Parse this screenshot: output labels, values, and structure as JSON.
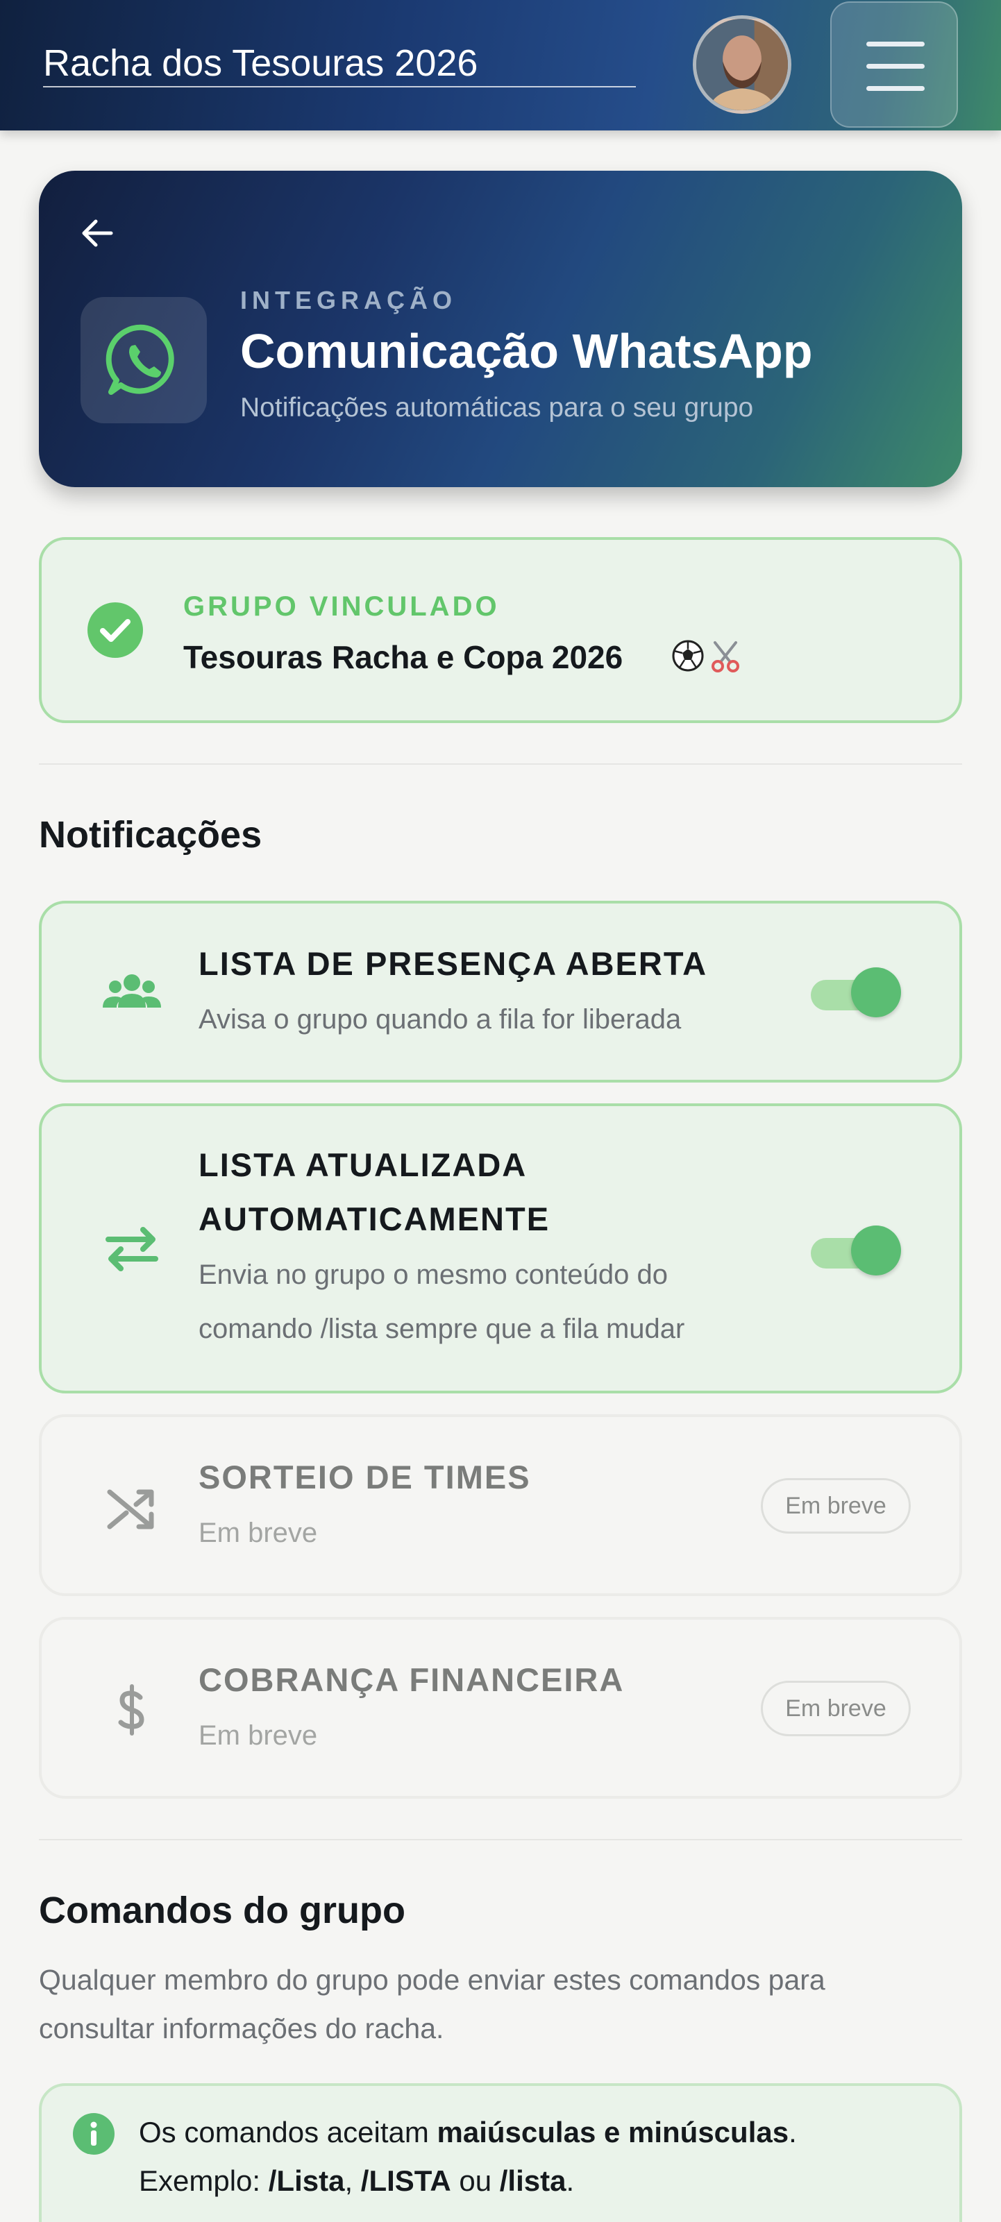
{
  "header": {
    "title": "Racha dos Tesouras 2026",
    "avatar_icon": "user-avatar",
    "menu_icon": "hamburger-menu-icon"
  },
  "hero": {
    "back_icon": "arrow-left-icon",
    "app_icon": "whatsapp-icon",
    "eyebrow": "INTEGRAÇÃO",
    "title": "Comunicação WhatsApp",
    "subtitle": "Notificações automáticas para o seu grupo"
  },
  "linked_group": {
    "status_icon": "check-circle-icon",
    "label": "GRUPO VINCULADO",
    "name": "Tesouras Racha e Copa 2026",
    "emojis": [
      "soccer-ball",
      "scissors"
    ]
  },
  "notifications": {
    "section_title": "Notificações",
    "items": [
      {
        "icon": "group-icon",
        "title": "LISTA DE PRESENÇA ABERTA",
        "description": "Avisa o grupo quando a fila for liberada",
        "enabled": true
      },
      {
        "icon": "swap-arrows-icon",
        "title_line1": "LISTA ATUALIZADA",
        "title_line2": "AUTOMATICAMENTE",
        "description_line1": "Envia no grupo o mesmo conteúdo do",
        "description_line2": "comando /lista sempre que a fila mudar",
        "enabled": true
      },
      {
        "icon": "shuffle-icon",
        "title": "SORTEIO DE TIMES",
        "description": "Em breve",
        "badge": "Em breve",
        "enabled": false
      },
      {
        "icon": "dollar-icon",
        "title": "COBRANÇA FINANCEIRA",
        "description": "Em breve",
        "badge": "Em breve",
        "enabled": false
      }
    ]
  },
  "commands": {
    "section_title": "Comandos do grupo",
    "intro_line1": "Qualquer membro do grupo pode enviar estes comandos para",
    "intro_line2": "consultar informações do racha.",
    "info": {
      "icon": "info-icon",
      "line1_prefix": "Os comandos aceitam ",
      "line1_bold": "maiúsculas e minúsculas",
      "line1_suffix": ".",
      "line2_prefix": "Exemplo: ",
      "example1": "/Lista",
      "sep1": ", ",
      "example2": "/LISTA",
      "sep2": " ou ",
      "example3": "/lista",
      "line2_suffix": "."
    }
  },
  "colors": {
    "brand_green": "#5bbd73",
    "header_dark_blue": "#10213f",
    "card_active_bg": "#eaf3ea",
    "card_active_border": "#a9dea8"
  }
}
